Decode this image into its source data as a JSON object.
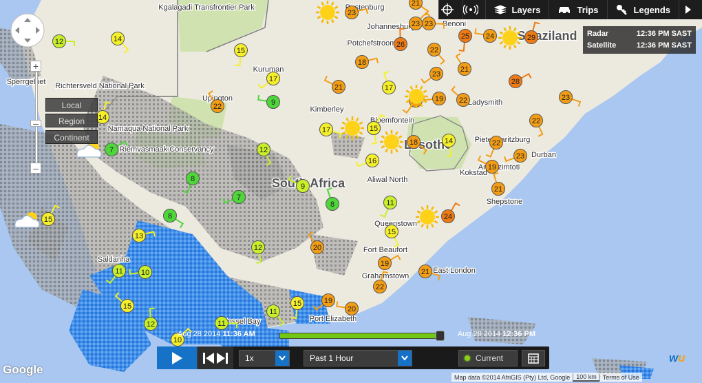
{
  "topbar": {
    "layers_label": "Layers",
    "trips_label": "Trips",
    "legends_label": "Legends"
  },
  "timecard": {
    "rows": [
      {
        "label": "Radar",
        "time": "12:36 PM SAST"
      },
      {
        "label": "Satellite",
        "time": "12:36 PM SAST"
      }
    ]
  },
  "scope": {
    "local": "Local",
    "region": "Region",
    "continent": "Continent"
  },
  "timeline": {
    "start_date": "Aug 28 2014",
    "start_time": "11:36 AM",
    "end_date": "Aug 28 2014",
    "end_time": "12:36 PM",
    "progress": 1.0
  },
  "controls": {
    "speed": "1x",
    "range": "Past 1 Hour",
    "current_label": "Current"
  },
  "footer": {
    "map_data": "Map data ©2014 AfriGIS (Pty) Ltd, Google",
    "scale": "100 km",
    "terms": "Terms of Use",
    "google": "Google",
    "wu": "wu"
  },
  "colors": {
    "cool": "#c8ef2a",
    "cold": "#4fd63a",
    "mild": "#f6f02a",
    "warm": "#f39d14",
    "hot": "#f07a13",
    "ocean": "#a9c7f0",
    "land": "#ece9df",
    "radar_blue": "#3a8ae8",
    "radar_gray": "#8c8c8c"
  },
  "places": [
    {
      "name": "Kgalagadi Transfrontier Park"
    },
    {
      "name": "Rustenburg"
    },
    {
      "name": "Benoni"
    },
    {
      "name": "Johannesburg"
    },
    {
      "name": "Potchefstroom"
    },
    {
      "name": "Swaziland"
    },
    {
      "name": "Kuruman"
    },
    {
      "name": "Upington"
    },
    {
      "name": "Kimberley"
    },
    {
      "name": "Bloemfontein"
    },
    {
      "name": "Ladysmith"
    },
    {
      "name": "Lesotho"
    },
    {
      "name": "Pietermaritzburg"
    },
    {
      "name": "Durban"
    },
    {
      "name": "Amanzimtoti"
    },
    {
      "name": "Kokstad"
    },
    {
      "name": "South Africa"
    },
    {
      "name": "Aliwal North"
    },
    {
      "name": "Shepstone"
    },
    {
      "name": "Queenstown"
    },
    {
      "name": "Fort Beaufort"
    },
    {
      "name": "Grahamstown"
    },
    {
      "name": "East London"
    },
    {
      "name": "Port Elizabeth"
    },
    {
      "name": "Sperrgebiet"
    },
    {
      "name": "Richtersveld National Park"
    },
    {
      "name": "Namaqua National Park"
    },
    {
      "name": "Riemvasmaak Conservancy"
    },
    {
      "name": "Saldanha"
    },
    {
      "name": "Mossel Bay"
    }
  ],
  "stations": [
    {
      "temp": 12,
      "level": "cool"
    },
    {
      "temp": 14,
      "level": "mild"
    },
    {
      "temp": 15,
      "level": "mild"
    },
    {
      "temp": 17,
      "level": "mild"
    },
    {
      "temp": 9,
      "level": "cold"
    },
    {
      "temp": 22,
      "level": "warm"
    },
    {
      "temp": 14,
      "level": "mild"
    },
    {
      "temp": 7,
      "level": "cold"
    },
    {
      "temp": 17,
      "level": "mild"
    },
    {
      "temp": 12,
      "level": "cool"
    },
    {
      "temp": 8,
      "level": "cold"
    },
    {
      "temp": 7,
      "level": "cold"
    },
    {
      "temp": 9,
      "level": "cool"
    },
    {
      "temp": 8,
      "level": "cold"
    },
    {
      "temp": 15,
      "level": "mild"
    },
    {
      "temp": 13,
      "level": "mild"
    },
    {
      "temp": 8,
      "level": "cold"
    },
    {
      "temp": 12,
      "level": "cool"
    },
    {
      "temp": 11,
      "level": "cool"
    },
    {
      "temp": 10,
      "level": "cool"
    },
    {
      "temp": 15,
      "level": "mild"
    },
    {
      "temp": 12,
      "level": "cool"
    },
    {
      "temp": 10,
      "level": "mild"
    },
    {
      "temp": 11,
      "level": "cool"
    },
    {
      "temp": 11,
      "level": "cool"
    },
    {
      "temp": 15,
      "level": "mild"
    },
    {
      "temp": 19,
      "level": "warm"
    },
    {
      "temp": 20,
      "level": "warm"
    },
    {
      "temp": 20,
      "level": "warm"
    },
    {
      "temp": 22,
      "level": "warm"
    },
    {
      "temp": 19,
      "level": "warm"
    },
    {
      "temp": 21,
      "level": "warm"
    },
    {
      "temp": 15,
      "level": "mild"
    },
    {
      "temp": 11,
      "level": "cool"
    },
    {
      "temp": 16,
      "level": "mild"
    },
    {
      "temp": 21,
      "level": "warm"
    },
    {
      "temp": 17,
      "level": "mild"
    },
    {
      "temp": 15,
      "level": "mild"
    },
    {
      "temp": 18,
      "level": "warm"
    },
    {
      "temp": 18,
      "level": "warm"
    },
    {
      "temp": 14,
      "level": "mild"
    },
    {
      "temp": 20,
      "level": "warm"
    },
    {
      "temp": 19,
      "level": "warm"
    },
    {
      "temp": 22,
      "level": "warm"
    },
    {
      "temp": 26,
      "level": "hot"
    },
    {
      "temp": 23,
      "level": "warm"
    },
    {
      "temp": 23,
      "level": "warm"
    },
    {
      "temp": 22,
      "level": "warm"
    },
    {
      "temp": 25,
      "level": "hot"
    },
    {
      "temp": 23,
      "level": "warm"
    },
    {
      "temp": 24,
      "level": "warm"
    },
    {
      "temp": 21,
      "level": "warm"
    },
    {
      "temp": 29,
      "level": "hot"
    },
    {
      "temp": 28,
      "level": "hot"
    },
    {
      "temp": 23,
      "level": "warm"
    },
    {
      "temp": 22,
      "level": "warm"
    },
    {
      "temp": 22,
      "level": "warm"
    },
    {
      "temp": 23,
      "level": "warm"
    },
    {
      "temp": 19,
      "level": "warm"
    },
    {
      "temp": 21,
      "level": "warm"
    },
    {
      "temp": 24,
      "level": "hot"
    },
    {
      "temp": 23,
      "level": "warm"
    },
    {
      "temp": 21,
      "level": "warm"
    },
    {
      "temp": 15,
      "level": "mild"
    }
  ]
}
